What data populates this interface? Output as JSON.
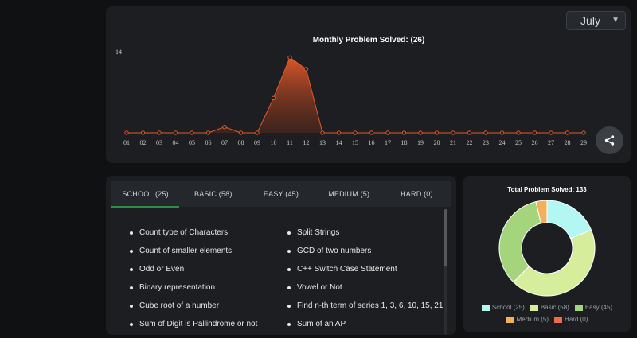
{
  "monthly_panel": {
    "month_selected": "July"
  },
  "chart_data": [
    {
      "type": "area",
      "title": "Monthly Problem Solved: (26)",
      "x": [
        "01",
        "02",
        "03",
        "04",
        "05",
        "06",
        "07",
        "08",
        "09",
        "10",
        "11",
        "12",
        "13",
        "14",
        "15",
        "16",
        "17",
        "18",
        "19",
        "20",
        "21",
        "22",
        "23",
        "24",
        "25",
        "26",
        "27",
        "28",
        "29"
      ],
      "series": [
        {
          "values": [
            0,
            0,
            0,
            0,
            0,
            0,
            1,
            0,
            0,
            6,
            13,
            11,
            0,
            0,
            0,
            0,
            0,
            0,
            0,
            0,
            0,
            0,
            0,
            0,
            0,
            0,
            0,
            0,
            0
          ]
        }
      ],
      "ylim": [
        0,
        14
      ],
      "ytick_label": "14",
      "color": "#e2592b",
      "grid": false
    },
    {
      "type": "pie",
      "donut": true,
      "title": "Total Problem Solved: 133",
      "categories": [
        "School (25)",
        "Basic (58)",
        "Easy (45)",
        "Medium (5)",
        "Hard (0)"
      ],
      "values": [
        25,
        58,
        45,
        5,
        0
      ],
      "colors": [
        "#b3f7f3",
        "#d6ee9c",
        "#a4d47c",
        "#f3b05a",
        "#ee6a4b"
      ]
    }
  ],
  "tabs": [
    {
      "label": "SCHOOL (25)"
    },
    {
      "label": "BASIC (58)"
    },
    {
      "label": "EASY (45)"
    },
    {
      "label": "MEDIUM (5)"
    },
    {
      "label": "HARD (0)"
    }
  ],
  "problems": {
    "left": [
      "Count type of Characters",
      "Count of smaller elements",
      "Odd or Even",
      "Binary representation",
      "Cube root of a number",
      "Sum of Digit is Pallindrome or not"
    ],
    "right": [
      "Split Strings",
      "GCD of two numbers",
      "C++ Switch Case Statement",
      "Vowel or Not",
      "Find n-th term of series 1, 3, 6, 10, 15, 21",
      "Sum of an AP"
    ]
  },
  "icons": {
    "share": "share-icon",
    "chevron": "chevron-down-icon"
  },
  "colors": {
    "accent": "#2f8d46",
    "panel": "#1c1e21",
    "background": "#0f1112"
  }
}
